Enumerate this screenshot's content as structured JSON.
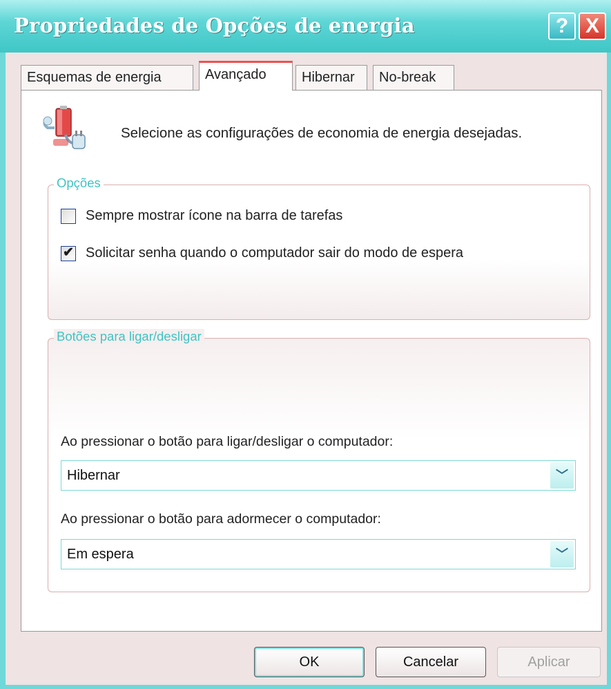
{
  "window": {
    "title": "Propriedades de Opções de energia",
    "help_icon": "?",
    "close_icon": "X"
  },
  "tabs": [
    {
      "label": "Esquemas de energia",
      "active": false
    },
    {
      "label": "Avançado",
      "active": true
    },
    {
      "label": "Hibernar",
      "active": false
    },
    {
      "label": "No-break",
      "active": false
    }
  ],
  "intro": {
    "icon": "battery-plug-icon",
    "text": "Selecione as configurações de economia de energia desejadas."
  },
  "options_group": {
    "legend": "Opções",
    "checkboxes": [
      {
        "label": "Sempre mostrar ícone na barra de tarefas",
        "checked": false
      },
      {
        "label": "Solicitar senha quando o computador sair do modo de espera",
        "checked": true
      }
    ]
  },
  "power_buttons_group": {
    "legend": "Botões para ligar/desligar",
    "power_button": {
      "label": "Ao pressionar o botão para ligar/desligar o computador:",
      "value": "Hibernar"
    },
    "sleep_button": {
      "label": "Ao pressionar o botão para adormecer o computador:",
      "value": "Em espera"
    }
  },
  "buttons": {
    "ok": "OK",
    "cancel": "Cancelar",
    "apply": "Aplicar"
  },
  "check_glyph": "✔",
  "combo_arrow_glyph": "﹀"
}
